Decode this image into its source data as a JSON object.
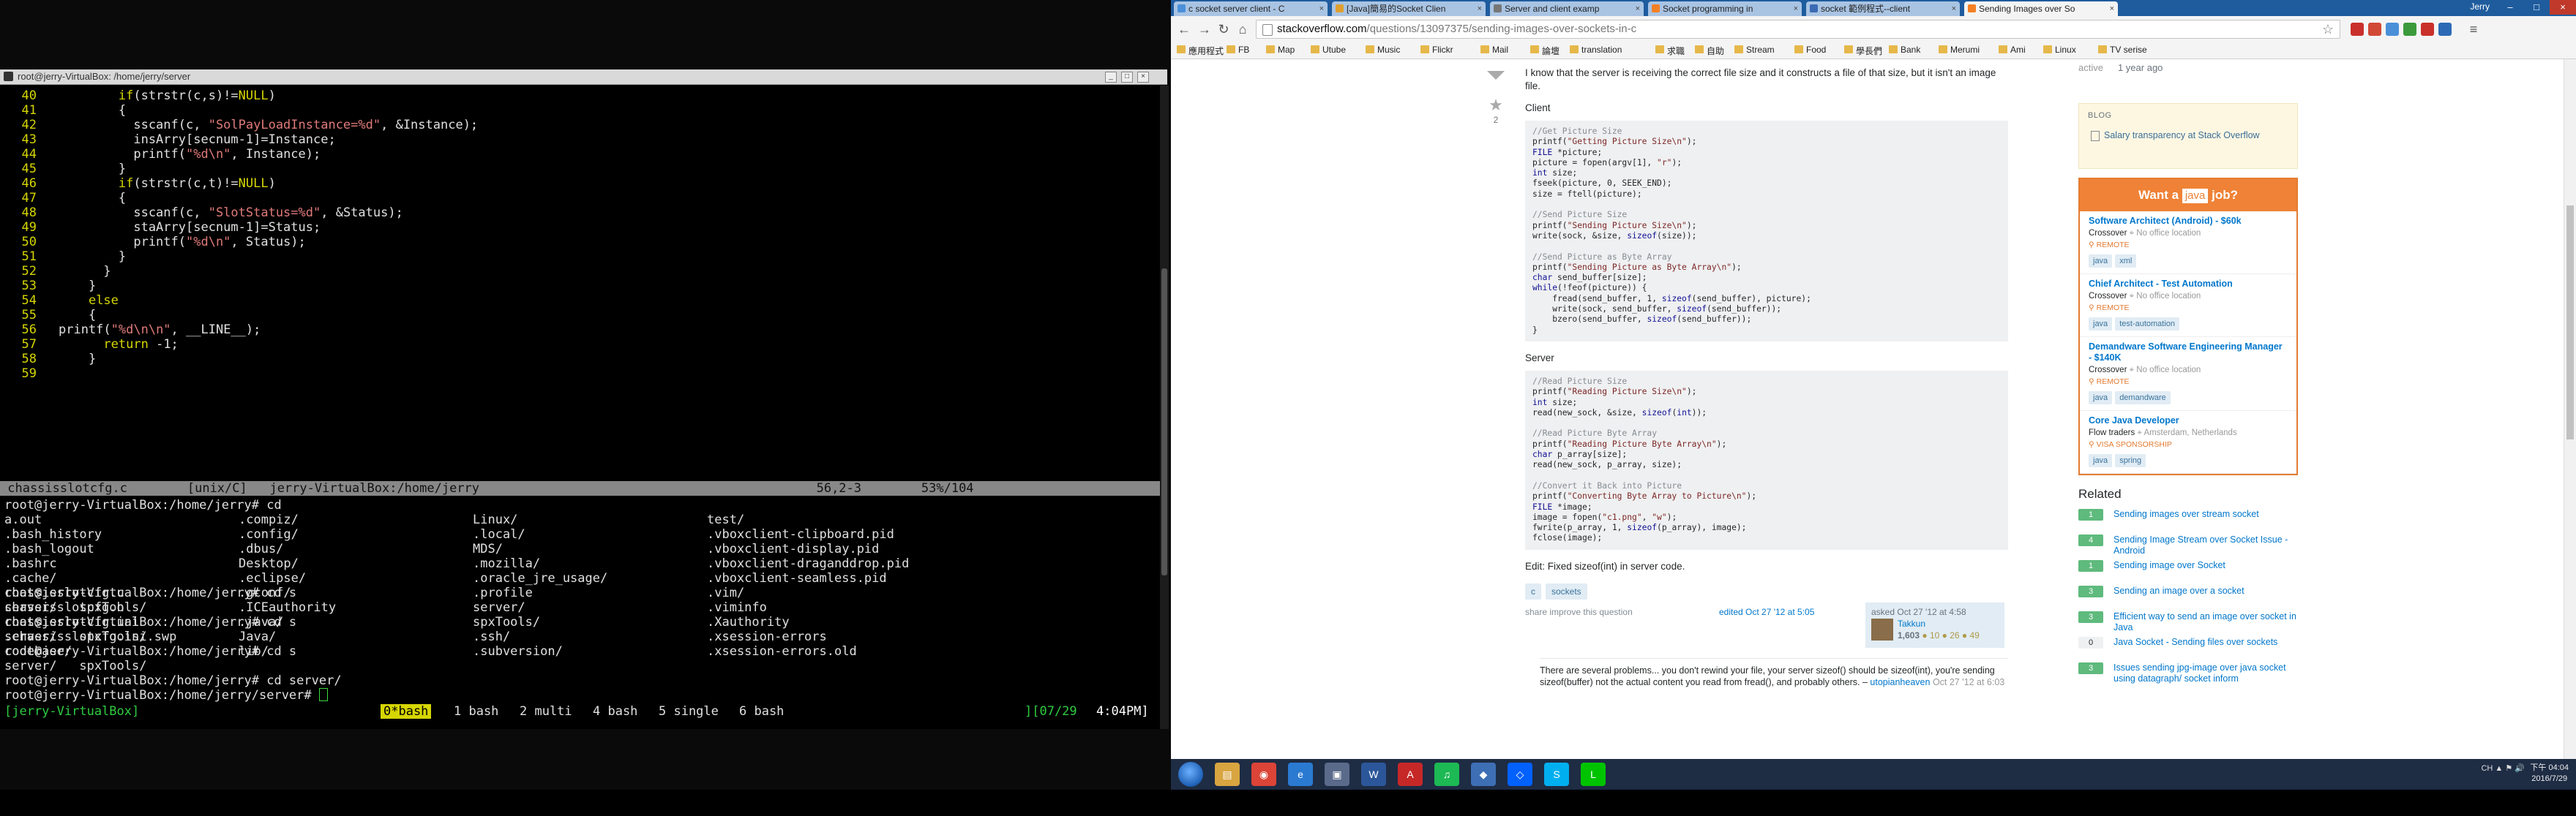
{
  "terminal": {
    "title": "root@jerry-VirtualBox: /home/jerry/server",
    "code_lines": [
      {
        "num": "40",
        "parts": [
          {
            "t": "        "
          },
          {
            "t": "if",
            "k": 1
          },
          {
            "t": "(strstr(c,s)!="
          },
          {
            "t": "NULL",
            "k": 1
          },
          {
            "t": ")"
          }
        ]
      },
      {
        "num": "41",
        "parts": [
          {
            "t": "        {"
          }
        ]
      },
      {
        "num": "42",
        "parts": [
          {
            "t": "          sscanf(c, "
          },
          {
            "t": "\"SolPayLoadInstance=%d\"",
            "s": 1
          },
          {
            "t": ", &Instance);"
          }
        ]
      },
      {
        "num": "43",
        "parts": [
          {
            "t": "          insArry[secnum-1]=Instance;"
          }
        ]
      },
      {
        "num": "44",
        "parts": [
          {
            "t": "          printf("
          },
          {
            "t": "\"%d\\n\"",
            "s": 1
          },
          {
            "t": ", Instance);"
          }
        ]
      },
      {
        "num": "45",
        "parts": [
          {
            "t": "        }"
          }
        ]
      },
      {
        "num": "46",
        "parts": [
          {
            "t": "        "
          },
          {
            "t": "if",
            "k": 1
          },
          {
            "t": "(strstr(c,t)!="
          },
          {
            "t": "NULL",
            "k": 1
          },
          {
            "t": ")"
          }
        ]
      },
      {
        "num": "47",
        "parts": [
          {
            "t": "        {"
          }
        ]
      },
      {
        "num": "48",
        "parts": [
          {
            "t": "          sscanf(c, "
          },
          {
            "t": "\"SlotStatus=%d\"",
            "s": 1
          },
          {
            "t": ", &Status);"
          }
        ]
      },
      {
        "num": "49",
        "parts": [
          {
            "t": "          staArry[secnum-1]=Status;"
          }
        ]
      },
      {
        "num": "50",
        "parts": [
          {
            "t": "          printf("
          },
          {
            "t": "\"%d\\n\"",
            "s": 1
          },
          {
            "t": ", Status);"
          }
        ]
      },
      {
        "num": "51",
        "parts": [
          {
            "t": "        }"
          }
        ]
      },
      {
        "num": "52",
        "parts": [
          {
            "t": "      }"
          }
        ]
      },
      {
        "num": "53",
        "parts": [
          {
            "t": "    }"
          }
        ]
      },
      {
        "num": "54",
        "parts": [
          {
            "t": "    "
          },
          {
            "t": "else",
            "k": 1
          }
        ]
      },
      {
        "num": "55",
        "parts": [
          {
            "t": "    {"
          }
        ]
      },
      {
        "num": "56",
        "parts": [
          {
            "t": "printf("
          },
          {
            "t": "\"%d\\n\\n\"",
            "s": 1
          },
          {
            "t": ", __LINE__);"
          }
        ]
      },
      {
        "num": "57",
        "parts": [
          {
            "t": "      "
          },
          {
            "t": "return",
            "k": 1
          },
          {
            "t": " -1;"
          }
        ]
      },
      {
        "num": "58",
        "parts": [
          {
            "t": "    }"
          }
        ]
      },
      {
        "num": "59",
        "parts": [
          {
            "t": ""
          }
        ]
      }
    ],
    "vim_status": " chassisslotcfg.c        [unix/C]   jerry-VirtualBox:/home/jerry                                             56,2-3        53%/104",
    "prompt_cd": "root@jerry-VirtualBox:/home/jerry# cd",
    "ls_columns": [
      [
        "a.out",
        ".bash_history",
        ".bash_logout",
        ".bashrc",
        ".cache/",
        "chassisslotcfg.c",
        "chassisslotcfg.h",
        "chassisslotcfg.ini",
        ".chassisslotcfg.ini.swp",
        "codebase/"
      ],
      [
        ".compiz/",
        ".config/",
        ".dbus/",
        "Desktop/",
        ".eclipse/",
        ".gconf/",
        ".ICEauthority",
        ".java/",
        "Java/",
        "lib/"
      ],
      [
        "Linux/",
        ".local/",
        "MDS/",
        ".mozilla/",
        ".oracle_jre_usage/",
        ".profile",
        "server/",
        "spxTools/",
        ".ssh/",
        ".subversion/"
      ],
      [
        "test/",
        ".vboxclient-clipboard.pid",
        ".vboxclient-display.pid",
        ".vboxclient-draganddrop.pid",
        ".vboxclient-seamless.pid",
        ".vim/",
        ".viminfo",
        ".Xauthority",
        ".xsession-errors",
        ".xsession-errors.old"
      ]
    ],
    "history": [
      "root@jerry-VirtualBox:/home/jerry# cd s",
      "server/   spxTools/",
      "root@jerry-VirtualBox:/home/jerry# cd s",
      "server/   spxTools/",
      "root@jerry-VirtualBox:/home/jerry# cd s",
      "server/   spxTools/",
      "root@jerry-VirtualBox:/home/jerry# cd server/"
    ],
    "current_prompt": "root@jerry-VirtualBox:/home/jerry/server# ",
    "screen": {
      "host": "[jerry-VirtualBox]",
      "active_window": "0*bash",
      "windows": [
        "1 bash",
        "2 multi",
        "4 bash",
        "5 single",
        "6 bash"
      ],
      "count": "][07/29",
      "clock": "4:04PM]"
    }
  },
  "browser": {
    "tabs": [
      {
        "label": "c socket server client - C",
        "color": "#4a90d9"
      },
      {
        "label": "[Java]簡易的Socket Clien",
        "color": "#e0a030"
      },
      {
        "label": "Server and client examp",
        "color": "#777"
      },
      {
        "label": "Socket programming in",
        "color": "#f48024"
      },
      {
        "label": "socket 範例程式--client",
        "color": "#3b6bb5"
      },
      {
        "label": "Sending Images over So",
        "color": "#f48024"
      }
    ],
    "profile": "Jerry",
    "url_host": "stackoverflow.com",
    "url_path": "/questions/13097375/sending-images-over-sockets-in-c",
    "bookmarks": [
      "應用程式",
      "FB",
      "Map",
      "Utube",
      "Music",
      "Flickr",
      "Mail",
      "論壇",
      "translation",
      "求職",
      "自助",
      "Stream",
      "Food",
      "學長們",
      "Bank",
      "Merumi",
      "Ami",
      "Linux",
      "TV serise"
    ]
  },
  "question": {
    "favorite_count": "2",
    "intro": "I know that the server is receiving the correct file size and it constructs a file of that size, but it isn't an image file.",
    "client_label": "Client",
    "client_code": [
      [
        {
          "t": "//Get Picture Size",
          "c": 1
        }
      ],
      [
        {
          "t": "printf("
        },
        {
          "t": "\"Getting Picture Size\\n\"",
          "s": 1
        },
        {
          "t": ");"
        }
      ],
      [
        {
          "t": "FILE",
          "k": 1
        },
        {
          "t": " *picture;"
        }
      ],
      [
        {
          "t": "picture = fopen(argv[1], "
        },
        {
          "t": "\"r\"",
          "s": 1
        },
        {
          "t": ");"
        }
      ],
      [
        {
          "t": "int",
          "k": 1
        },
        {
          "t": " size;"
        }
      ],
      [
        {
          "t": "fseek(picture, 0, SEEK_END);"
        }
      ],
      [
        {
          "t": "size = ftell(picture);"
        }
      ],
      [
        {
          "t": ""
        }
      ],
      [
        {
          "t": "//Send Picture Size",
          "c": 1
        }
      ],
      [
        {
          "t": "printf("
        },
        {
          "t": "\"Sending Picture Size\\n\"",
          "s": 1
        },
        {
          "t": ");"
        }
      ],
      [
        {
          "t": "write(sock, &size, "
        },
        {
          "t": "sizeof",
          "k": 1
        },
        {
          "t": "(size));"
        }
      ],
      [
        {
          "t": ""
        }
      ],
      [
        {
          "t": "//Send Picture as Byte Array",
          "c": 1
        }
      ],
      [
        {
          "t": "printf("
        },
        {
          "t": "\"Sending Picture as Byte Array\\n\"",
          "s": 1
        },
        {
          "t": ");"
        }
      ],
      [
        {
          "t": "char",
          "k": 1
        },
        {
          "t": " send_buffer[size];"
        }
      ],
      [
        {
          "t": "while",
          "k": 1
        },
        {
          "t": "(!feof(picture)) {"
        }
      ],
      [
        {
          "t": "    fread(send_buffer, 1, "
        },
        {
          "t": "sizeof",
          "k": 1
        },
        {
          "t": "(send_buffer), picture);"
        }
      ],
      [
        {
          "t": "    write(sock, send_buffer, "
        },
        {
          "t": "sizeof",
          "k": 1
        },
        {
          "t": "(send_buffer));"
        }
      ],
      [
        {
          "t": "    bzero(send_buffer, "
        },
        {
          "t": "sizeof",
          "k": 1
        },
        {
          "t": "(send_buffer));"
        }
      ],
      [
        {
          "t": "}"
        }
      ]
    ],
    "server_label": "Server",
    "server_code": [
      [
        {
          "t": "//Read Picture Size",
          "c": 1
        }
      ],
      [
        {
          "t": "printf("
        },
        {
          "t": "\"Reading Picture Size\\n\"",
          "s": 1
        },
        {
          "t": ");"
        }
      ],
      [
        {
          "t": "int",
          "k": 1
        },
        {
          "t": " size;"
        }
      ],
      [
        {
          "t": "read(new_sock, &size, "
        },
        {
          "t": "sizeof",
          "k": 1
        },
        {
          "t": "("
        },
        {
          "t": "int",
          "k": 1
        },
        {
          "t": "));"
        }
      ],
      [
        {
          "t": ""
        }
      ],
      [
        {
          "t": "//Read Picture Byte Array",
          "c": 1
        }
      ],
      [
        {
          "t": "printf("
        },
        {
          "t": "\"Reading Picture Byte Array\\n\"",
          "s": 1
        },
        {
          "t": ");"
        }
      ],
      [
        {
          "t": "char",
          "k": 1
        },
        {
          "t": " p_array[size];"
        }
      ],
      [
        {
          "t": "read(new_sock, p_array, size);"
        }
      ],
      [
        {
          "t": ""
        }
      ],
      [
        {
          "t": "//Convert it Back into Picture",
          "c": 1
        }
      ],
      [
        {
          "t": "printf("
        },
        {
          "t": "\"Converting Byte Array to Picture\\n\"",
          "s": 1
        },
        {
          "t": ");"
        }
      ],
      [
        {
          "t": "FILE",
          "k": 1
        },
        {
          "t": " *image;"
        }
      ],
      [
        {
          "t": "image = fopen("
        },
        {
          "t": "\"c1.png\"",
          "s": 1
        },
        {
          "t": ", "
        },
        {
          "t": "\"w\"",
          "s": 1
        },
        {
          "t": ");"
        }
      ],
      [
        {
          "t": "fwrite(p_array, 1, "
        },
        {
          "t": "sizeof",
          "k": 1
        },
        {
          "t": "(p_array), image);"
        }
      ],
      [
        {
          "t": "fclose(image);"
        }
      ]
    ],
    "edit_note": "Edit: Fixed sizeof(int) in server code.",
    "tags": [
      "c",
      "sockets"
    ],
    "share_text": "share   improve this question",
    "edited_text": "edited Oct 27 '12 at 5:05",
    "asked_text": "asked Oct 27 '12 at 4:58",
    "owner_name": "Takkun",
    "owner_rep": "1,603",
    "owner_badges": "● 10  ● 26  ● 49",
    "comment_text": "There are several problems... you don't rewind your file, your server sizeof() should be sizeof(int), you're sending sizeof(buffer) not the actual content you read from fread(), and probably others. – ",
    "comment_user": "utopianheaven",
    "comment_date": "Oct 27 '12 at 6:03"
  },
  "sidebar": {
    "activity_label": "active",
    "activity_value": "1 year ago",
    "blog_title": "BLOG",
    "blog_link": "Salary transparency at Stack Overflow",
    "jobs_head_pre": "Want a",
    "jobs_head_hl": "java",
    "jobs_head_post": "job?",
    "jobs": [
      {
        "title": "Software Architect (Android) - $60k",
        "company": "Crossover",
        "loc": "No office location",
        "perk": "REMOTE",
        "tags": [
          "java",
          "xml"
        ]
      },
      {
        "title": "Chief Architect - Test Automation",
        "company": "Crossover",
        "loc": "No office location",
        "perk": "REMOTE",
        "tags": [
          "java",
          "test-automation"
        ]
      },
      {
        "title": "Demandware Software Engineering Manager - $140K",
        "company": "Crossover",
        "loc": "No office location",
        "perk": "REMOTE",
        "tags": [
          "java",
          "demandware"
        ]
      },
      {
        "title": "Core Java Developer",
        "company": "Flow traders",
        "loc": "Amsterdam, Netherlands",
        "perk": "VISA SPONSORSHIP",
        "tags": [
          "java",
          "spring"
        ]
      }
    ],
    "related_title": "Related",
    "related": [
      {
        "count": "1",
        "text": "Sending images over stream socket"
      },
      {
        "count": "4",
        "text": "Sending Image Stream over Socket Issue - Android"
      },
      {
        "count": "1",
        "text": "Sending image over Socket"
      },
      {
        "count": "3",
        "text": "Sending an image over a socket"
      },
      {
        "count": "3",
        "text": "Efficient way to send an image over socket in Java"
      },
      {
        "count": "0",
        "text": "Java Socket - Sending files over sockets"
      },
      {
        "count": "3",
        "text": "Issues sending jpg-image over java socket using datagraph/ socket inform"
      }
    ]
  },
  "taskbar": {
    "apps": [
      "explorer",
      "chrome",
      "ie",
      "vm",
      "word",
      "pdf",
      "spotify",
      "vbox",
      "dropbox",
      "skype",
      "line"
    ],
    "tray": "CH  ▲  ⚑  🔊",
    "time": "下午 04:04",
    "date": "2016/7/29"
  }
}
